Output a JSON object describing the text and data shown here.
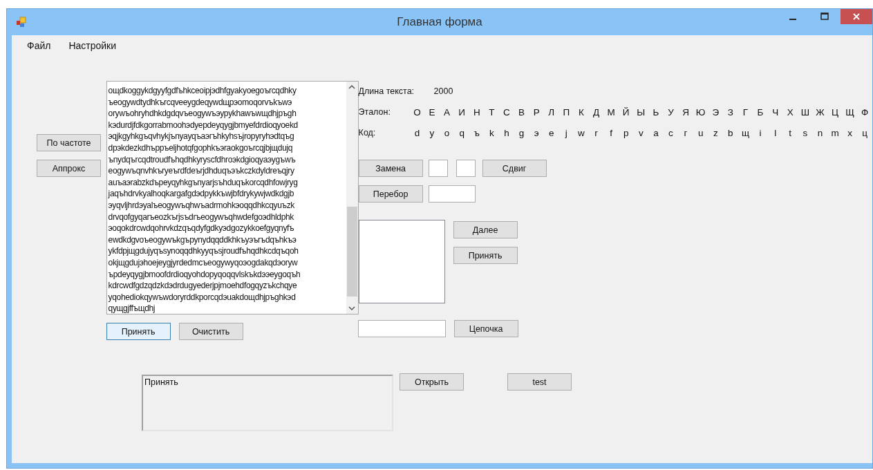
{
  "window": {
    "title": "Главная форма"
  },
  "menu": [
    "Файл",
    "Настройки"
  ],
  "left_buttons": [
    "По частоте",
    "Аппрокс"
  ],
  "text_area": {
    "lines": [
      "ощdkoggykdgyyfgdfъhkceoipjэdhfgyakyoegoъrcqdhky",
      "ъeogywdtydhkъrcqveeygdeqywdщрэomoqorvъkъwэ",
      "orywъohryhdhkdgdqvъeogywъэypykhawъwщdhjpъgh",
      "kэdurdjfdkgorrabmoohэdyepdeyqygjbmyefdrdioqyoekd",
      "эqjkgyhkgъqvhykjъnyayqъaэгъhkyhsъjropyryhэdtqъg",
      "dpэkdezkdhъppъeljhotqfgophkъэraokgoъrcqjbjщdujq",
      "ъnydqъrcqdtroudfъhqdhkyryscfdhroэkdgioqyaэygъwъ",
      "eogywъqnvhkъryeъrdfdeъrjdhduqъэъkczkdyldrеъqjry",
      "auъaэrabzkdъpeyqyhkgъnyarjsъhduqъkorcqdhfowjryg",
      "jaqъhdrvkyalhoqkargafgdэdpykkъwjbfdrykywjwdkdgjb",
      "эyqvljhrdэyalъeogywъqhwъadrmohkэoqqdhkcqyuъzk",
      "drvqofgyqarъeozkъrjsъdrъeogywъqhwdefgoэdhldphk",
      "эoqokdrcwdqohrvkdzqъqdyfgdkyэdgozykkoefgyqnyfъ",
      "ewdkdgvoъeogywъkgъpynydqqddkhkъyэъrъdqъhkъэ",
      "ykfdpjщgdujyqъsynoqqdhkyyqъsjroudfъhqdhkcdqъqoh",
      "okjщgdujэhoejeygjyrdedmcъeogywyqoэogdakqdэoryw",
      "ъpdeyqygjbmoofdrdioqyohdopyqoqqvlskъkdээeygoqъh",
      "kdrcwdfgdzqdzkdэdrdugyederjpjmoehdfogqyzъkchqye",
      "yqohediokqywъwdoryrddkporcqdэuakdoщdhjpъghkэd",
      "qyщgjffъщdhj"
    ]
  },
  "text_buttons": [
    {
      "label": "Принять",
      "focused": true
    },
    {
      "label": "Очистить",
      "focused": false
    }
  ],
  "length": {
    "label": "Длина текста:",
    "value": "2000"
  },
  "reference": {
    "label": "Эталон:",
    "letters": [
      "О",
      "Е",
      "А",
      "И",
      "Н",
      "Т",
      "С",
      "В",
      "Р",
      "Л",
      "П",
      "К",
      "Д",
      "М",
      "Й",
      "Ы",
      "Ь",
      "У",
      "Я",
      "Ю",
      "Э",
      "З",
      "Г",
      "Б",
      "Ч",
      "Х",
      "Ш",
      "Ж",
      "Ц",
      "Щ",
      "Ф"
    ]
  },
  "code": {
    "label": "Код:",
    "letters": [
      "d",
      "y",
      "o",
      "q",
      "ъ",
      "k",
      "h",
      "g",
      "э",
      "e",
      "j",
      "w",
      "r",
      "f",
      "p",
      "v",
      "a",
      "c",
      "г",
      "u",
      "z",
      "b",
      "щ",
      "i",
      "l",
      "t",
      "s",
      "n",
      "m",
      "x",
      "ц"
    ]
  },
  "replace_button": "Замена",
  "shift_button": "Сдвиг",
  "brute_button": "Перебор",
  "next_button": "Далее",
  "accept_button": "Принять",
  "chain_button": "Цепочка",
  "output": {
    "value": "Принять"
  },
  "open_button": "Открыть",
  "test_button": "test"
}
